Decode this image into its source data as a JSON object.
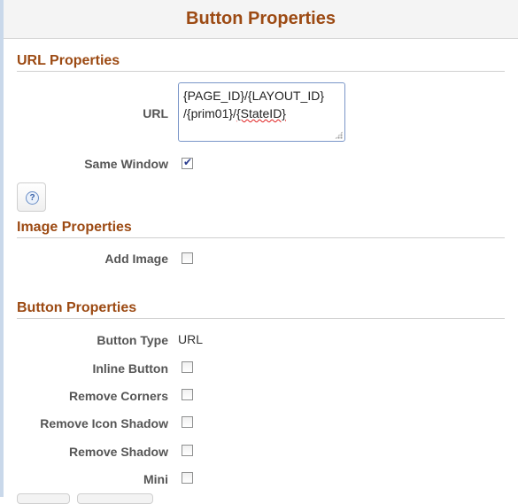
{
  "header": {
    "title": "Button Properties"
  },
  "url_section": {
    "title": "URL Properties",
    "url_label": "URL",
    "url_value_line1": "{PAGE_ID}/{LAYOUT_ID}",
    "url_value_line2_prefix": "/{prim01}/",
    "url_value_line2_spell": "{StateID}",
    "same_window_label": "Same Window",
    "same_window_checked": true
  },
  "image_section": {
    "title": "Image Properties",
    "add_image_label": "Add Image",
    "add_image_checked": false
  },
  "button_section": {
    "title": "Button Properties",
    "button_type_label": "Button Type",
    "button_type_value": "URL",
    "inline_button_label": "Inline Button",
    "remove_corners_label": "Remove Corners",
    "remove_icon_shadow_label": "Remove Icon Shadow",
    "remove_shadow_label": "Remove Shadow",
    "mini_label": "Mini"
  },
  "icons": {
    "help": "help-icon",
    "check": "checkmark-icon"
  },
  "colors": {
    "section_title": "#9c4a13",
    "check": "#2a3c8e",
    "textarea_border": "#7a96c8"
  }
}
